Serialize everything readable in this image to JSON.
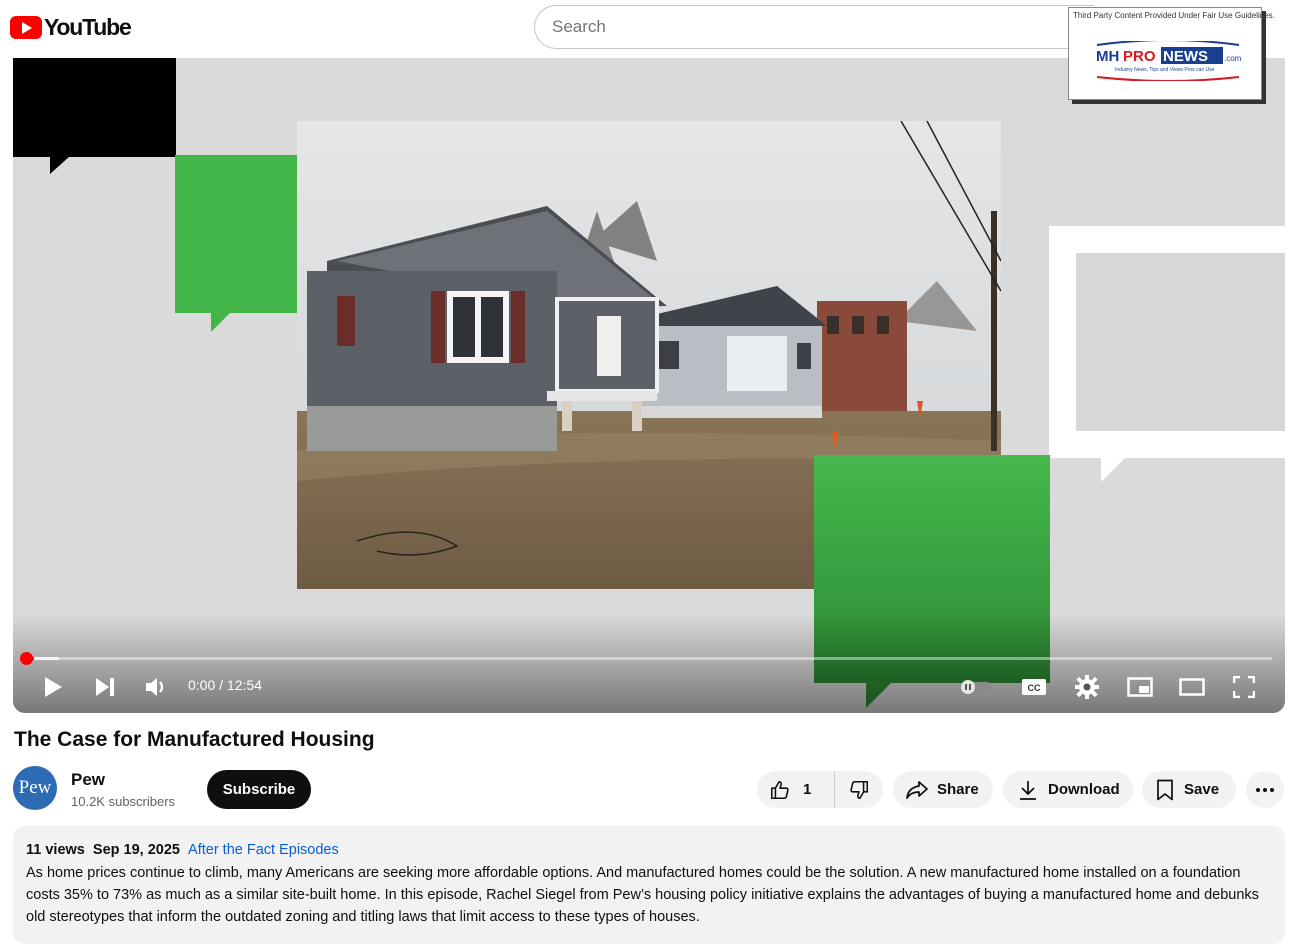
{
  "header": {
    "logo_text": "YouTube",
    "search_placeholder": "Search"
  },
  "watermark": {
    "note": "Third Party Content Provided Under Fair Use Guidelines.",
    "brand": "MHPRONEWS",
    "brand_suffix": ".com",
    "tagline": "Industry News, Tips and Views Pros can Use"
  },
  "player": {
    "time_current": "0:00",
    "time_separator": " / ",
    "time_total": "12:54",
    "progress_played_fraction": 0.007,
    "progress_loaded_fraction": 0.027
  },
  "video": {
    "title": "The Case for Manufactured Housing"
  },
  "channel": {
    "avatar_text": "Pew",
    "name": "Pew",
    "subscribers": "10.2K subscribers",
    "subscribe_label": "Subscribe"
  },
  "actions": {
    "like_count": "1",
    "share_label": "Share",
    "download_label": "Download",
    "save_label": "Save"
  },
  "description": {
    "views": "11 views",
    "date": "Sep 19, 2025",
    "tag": "After the Fact Episodes",
    "text": "As home prices continue to climb, many Americans are seeking more affordable options. And manufactured homes could be the solution. A new manufactured home installed on a foundation costs 35% to 73% as much as a similar site-built home. In this episode, Rachel Siegel from Pew’s housing policy initiative explains the advantages of buying a manufactured home and debunks old stereotypes that inform the outdated zoning and titling laws that limit access to these types of houses."
  },
  "colors": {
    "accent_red": "#ff0000",
    "pew_green": "#43b649",
    "link_blue": "#065fd4",
    "avatar_blue": "#2d6bb5"
  }
}
